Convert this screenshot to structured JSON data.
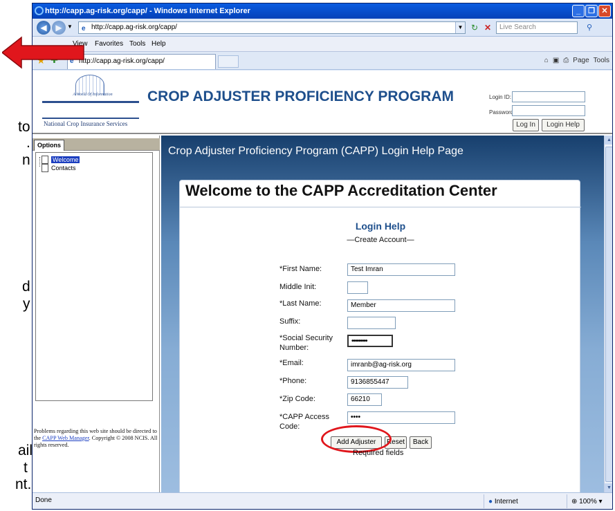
{
  "slide": {
    "side_text": [
      "to",
      ".",
      "n",
      "d",
      "y",
      "ail",
      "t",
      "nt."
    ]
  },
  "browser": {
    "title": "http://capp.ag-risk.org/capp/ - Windows Internet Explorer",
    "address": "http://capp.ag-risk.org/capp/",
    "search_placeholder": "Live Search",
    "menu": [
      "View",
      "Favorites",
      "Tools",
      "Help"
    ],
    "tab_label": "http://capp.ag-risk.org/capp/",
    "commands": {
      "page": "Page",
      "tools": "Tools"
    }
  },
  "site": {
    "logo_motto": "A World Of Information",
    "logo_name": "National Crop Insurance Services",
    "title": "CROP ADJUSTER PROFICIENCY PROGRAM",
    "login_id_label": "Login ID:",
    "password_label": "Password:",
    "login_button": "Log In",
    "login_help_button": "Login Help"
  },
  "sidebar": {
    "tab": "Options",
    "items": [
      {
        "label": "Welcome",
        "selected": true
      },
      {
        "label": "Contacts",
        "selected": false
      }
    ],
    "footer_line1": "Problems regarding this web site should be directed to the",
    "footer_link": "CAPP Web Manager",
    "footer_line2": "Copyright © 2008 NCIS. All rights reserved."
  },
  "main": {
    "page_heading": "Crop Adjuster Proficiency Program (CAPP) Login Help Page",
    "card_title": "Welcome to the CAPP Accreditation Center",
    "section_title": "Login Help",
    "section_subtitle": "—Create Account—",
    "fields": {
      "first_name": {
        "label": "*First Name:",
        "value": "Test Imran"
      },
      "middle_init": {
        "label": "Middle Init:",
        "value": ""
      },
      "last_name": {
        "label": "*Last Name:",
        "value": "Member"
      },
      "suffix": {
        "label": "Suffix:",
        "value": ""
      },
      "ssn": {
        "label_line1": "*Social Security",
        "label_line2": "Number:",
        "value": "•••••••••"
      },
      "email": {
        "label": "*Email:",
        "value": "imranb@ag-risk.org"
      },
      "phone": {
        "label": "*Phone:",
        "value": "9136855447"
      },
      "zip": {
        "label": "*Zip Code:",
        "value": "66210"
      },
      "access_code": {
        "label_line1": "*CAPP Access",
        "label_line2": "Code:",
        "value": "••••"
      }
    },
    "buttons": {
      "add": "Add Adjuster",
      "reset": "Reset",
      "back": "Back"
    },
    "required_note": "Required fields"
  },
  "status": {
    "left": "Done",
    "zone": "Internet",
    "zoom": "100%"
  },
  "colors": {
    "highlight_oval": "#e0161c",
    "arrow": "#e0161c"
  }
}
